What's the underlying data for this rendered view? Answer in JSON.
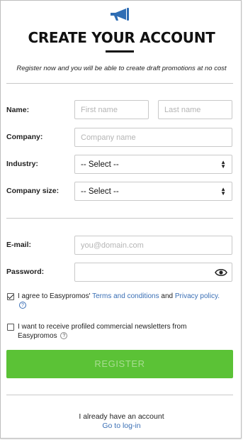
{
  "header": {
    "icon": "megaphone-icon",
    "title": "CREATE YOUR ACCOUNT",
    "subtitle": "Register now and you will be able to create draft promotions at no cost"
  },
  "form": {
    "name_label": "Name:",
    "first_name_placeholder": "First name",
    "last_name_placeholder": "Last name",
    "company_label": "Company:",
    "company_placeholder": "Company name",
    "industry_label": "Industry:",
    "industry_value": "-- Select --",
    "company_size_label": "Company size:",
    "company_size_value": "-- Select --",
    "email_label": "E-mail:",
    "email_placeholder": "you@domain.com",
    "password_label": "Password:",
    "password_icon": "eye-icon",
    "terms": {
      "checked": true,
      "prefix": "I agree to Easypromos'",
      "terms_link": "Terms and conditions",
      "and": "and",
      "privacy_link": "Privacy policy",
      "suffix": "."
    },
    "newsletter": {
      "checked": false,
      "text_line1": "I want to receive profiled commercial newsletters from",
      "text_line2": "Easypromos"
    },
    "register_label": "REGISTER"
  },
  "footer": {
    "have_account": "I already have an account",
    "login_link": "Go to log-in"
  },
  "colors": {
    "accent_green": "#5bc236",
    "link_blue": "#3a6fb5",
    "icon_blue": "#2f6db4"
  }
}
